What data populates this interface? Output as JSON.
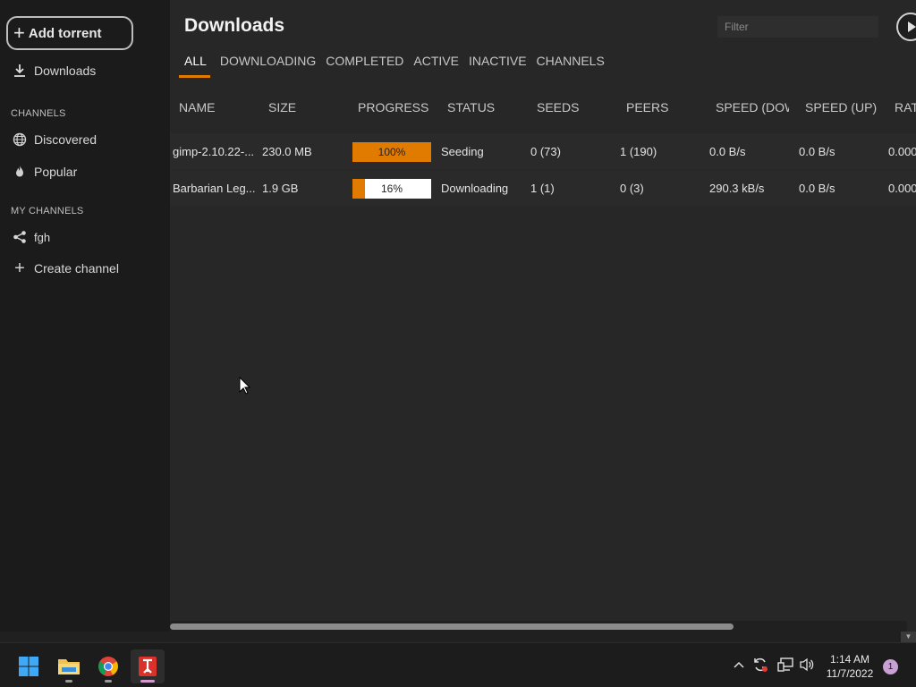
{
  "sidebar": {
    "add_torrent": "Add torrent",
    "downloads": "Downloads",
    "channels_heading": "CHANNELS",
    "discovered": "Discovered",
    "popular": "Popular",
    "my_channels_heading": "MY CHANNELS",
    "my_channel_name": "fgh",
    "create_channel": "Create channel"
  },
  "main": {
    "title": "Downloads",
    "filter_placeholder": "Filter",
    "tabs": [
      "ALL",
      "DOWNLOADING",
      "COMPLETED",
      "ACTIVE",
      "INACTIVE",
      "CHANNELS"
    ],
    "active_tab": "ALL",
    "columns": [
      "NAME",
      "SIZE",
      "PROGRESS",
      "STATUS",
      "SEEDS",
      "PEERS",
      "SPEED (DOW",
      "SPEED (UP)",
      "RAT"
    ],
    "rows": [
      {
        "name": "gimp-2.10.22-...",
        "size": "230.0 MB",
        "progress": 100,
        "progress_label": "100%",
        "status": "Seeding",
        "seeds": "0 (73)",
        "peers": "1 (190)",
        "speed_down": "0.0 B/s",
        "speed_up": "0.0 B/s",
        "ratio": "0.000"
      },
      {
        "name": "Barbarian Leg...",
        "size": "1.9 GB",
        "progress": 16,
        "progress_label": "16%",
        "status": "Downloading",
        "seeds": "1 (1)",
        "peers": "0 (3)",
        "speed_down": "290.3 kB/s",
        "speed_up": "0.0 B/s",
        "ratio": "0.000"
      }
    ]
  },
  "taskbar": {
    "time": "1:14 AM",
    "date": "11/7/2022",
    "notifications": "1"
  },
  "colors": {
    "accent": "#e07b00",
    "sidebar_bg": "#1b1b1b",
    "main_bg": "#272727"
  }
}
